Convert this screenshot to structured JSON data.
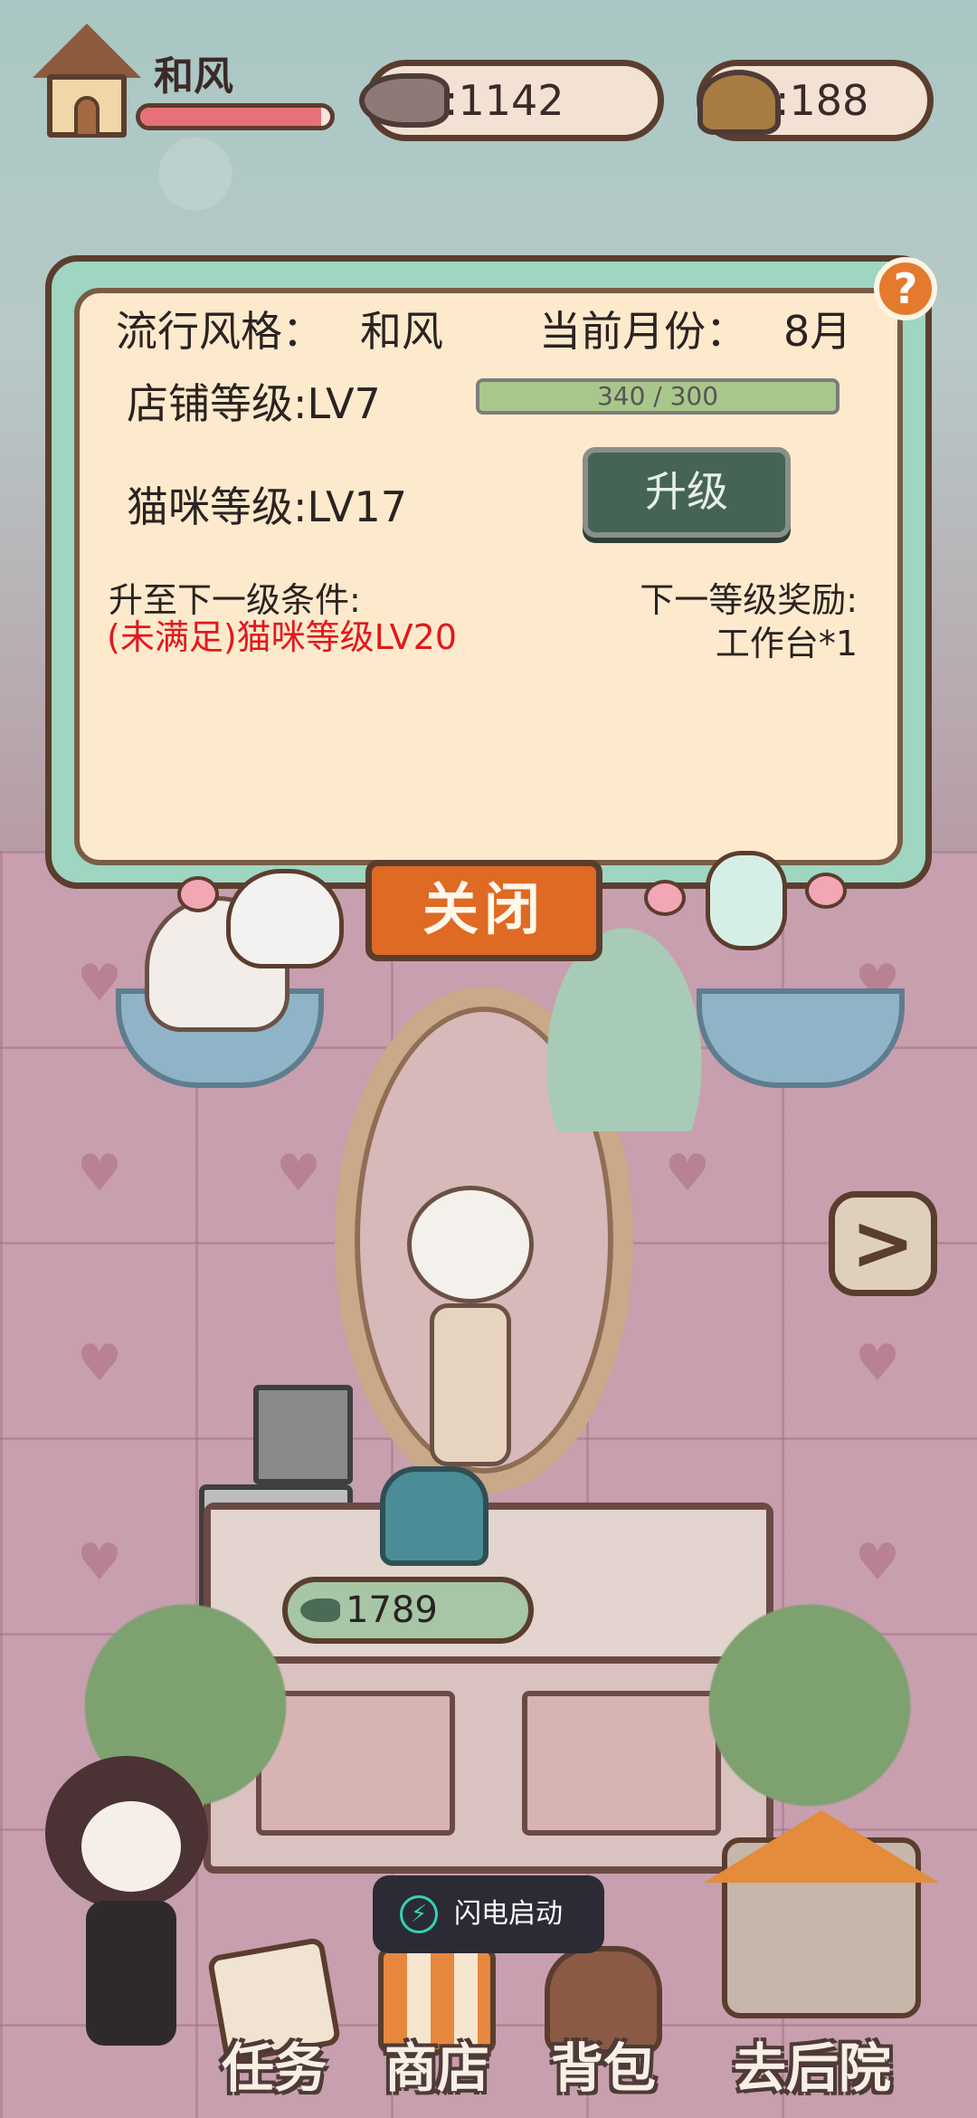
{
  "hud": {
    "player_name": "和风",
    "exp_fraction": 0.95,
    "fish_currency": ":1142",
    "poop_currency": ":188"
  },
  "panel": {
    "style_label": "流行风格：",
    "style_value": "和风",
    "month_label": "当前月份：",
    "month_value": "8月",
    "shop_level": "店铺等级:LV7",
    "shop_progress_text": "340 / 300",
    "shop_progress_fraction": 1.0,
    "cat_level": "猫咪等级:LV17",
    "upgrade_label": "升级",
    "condition_title": "升至下一级条件:",
    "condition_text": "(未满足)猫咪等级LV20",
    "reward_title": "下一等级奖励:",
    "reward_item": "工作台*1",
    "help_symbol": "?",
    "close_label": "关闭"
  },
  "scene": {
    "desk_fish_count": "1789",
    "next_arrow": ">"
  },
  "toast": {
    "text": "闪电启动"
  },
  "nav": {
    "task": "任务",
    "shop": "商店",
    "bag": "背包",
    "backyard": "去后院"
  },
  "colors": {
    "panel_border": "#9ed6c1",
    "panel_bg": "#fdeacc",
    "close_button": "#de6a24",
    "upgrade_button": "#466454",
    "condition_text": "#e2181e",
    "hp_bar": "#e77178"
  }
}
